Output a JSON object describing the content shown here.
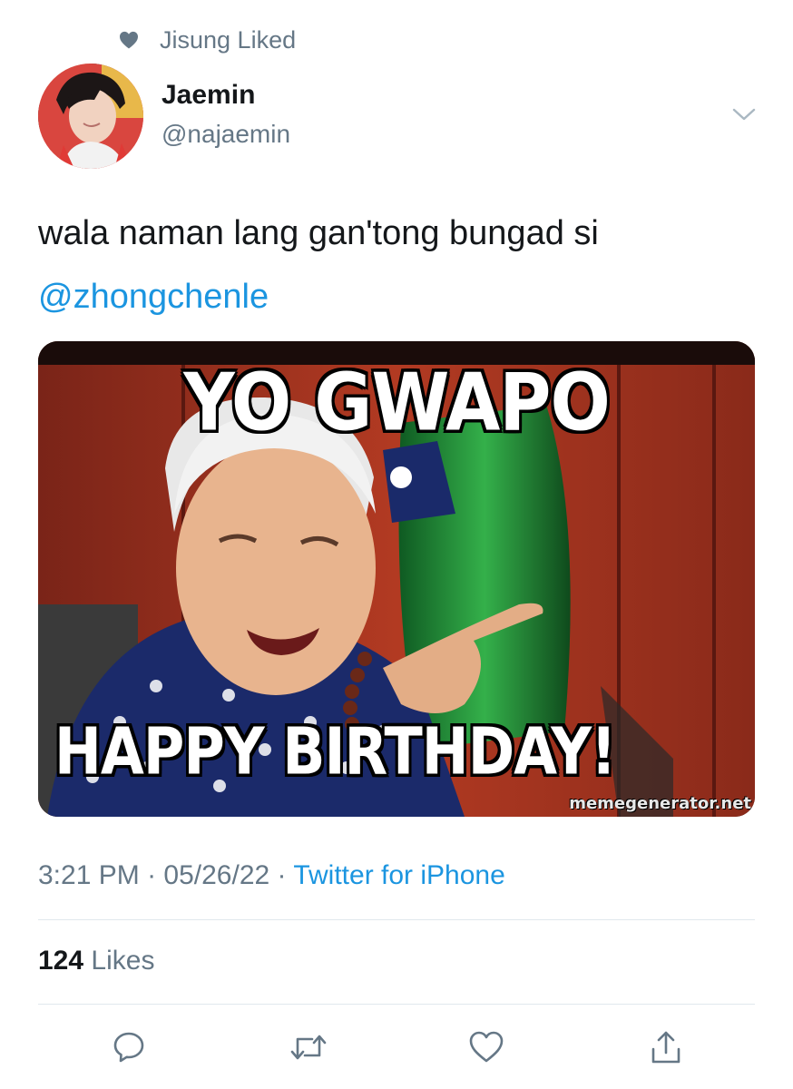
{
  "social_context": {
    "icon": "heart-icon",
    "text": "Jisung Liked"
  },
  "author": {
    "name": "Jaemin",
    "handle": "@najaemin",
    "avatar_icon": "avatar"
  },
  "tweet": {
    "text": "wala naman lang gan'tong bungad si",
    "mention": "@zhongchenle"
  },
  "media": {
    "top_text": "YO GWAPO",
    "bottom_text": "HAPPY BIRTHDAY!",
    "credit": "memegenerator.net"
  },
  "meta": {
    "time": "3:21 PM",
    "separator": "·",
    "date": "05/26/22",
    "source": "Twitter for iPhone"
  },
  "engagement": {
    "likes_count": "124",
    "likes_label": "Likes"
  },
  "actions": [
    {
      "name": "reply",
      "icon": "reply-icon"
    },
    {
      "name": "retweet",
      "icon": "retweet-icon"
    },
    {
      "name": "like",
      "icon": "heart-outline-icon"
    },
    {
      "name": "share",
      "icon": "share-icon"
    }
  ],
  "colors": {
    "accent": "#1b95e0",
    "secondary_text": "#657786",
    "primary_text": "#14171a",
    "divider": "#e1e8ed"
  }
}
